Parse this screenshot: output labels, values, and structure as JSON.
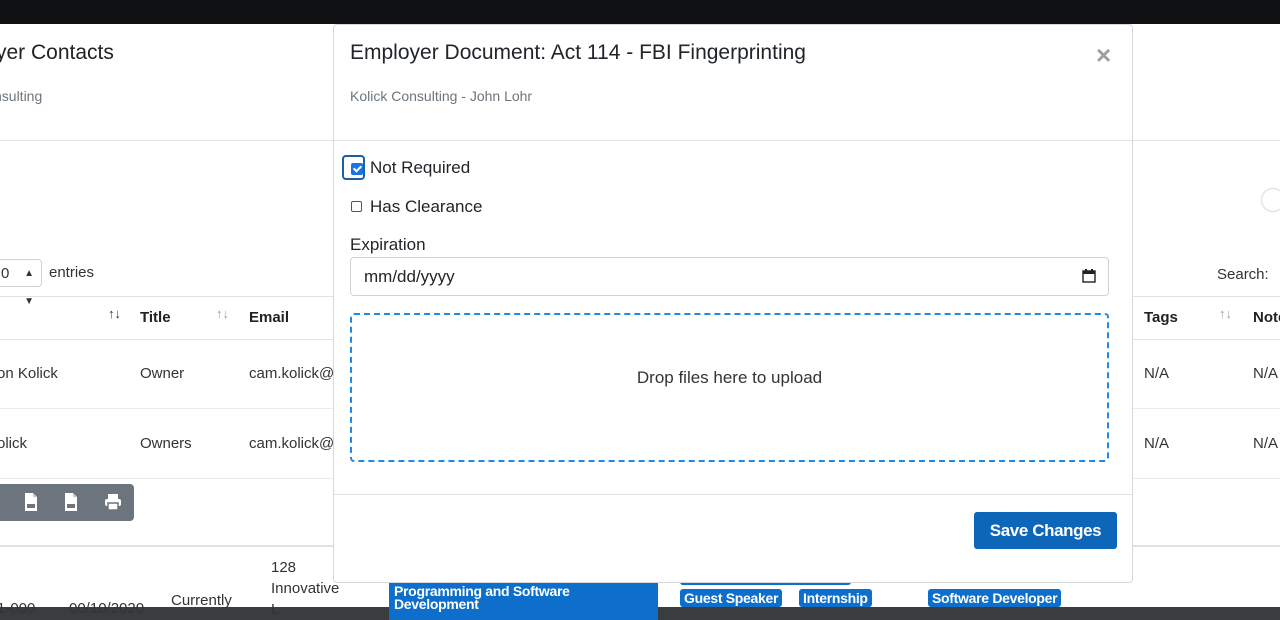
{
  "background": {
    "page_title": "yer Contacts",
    "page_subtitle": "nsulting",
    "entries_select_value": "0",
    "entries_label": "entries",
    "search_label": "Search:",
    "table": {
      "headers": {
        "name": "",
        "title": "Title",
        "email": "Email",
        "tags": "Tags",
        "notes": "Note"
      },
      "rows": [
        {
          "name": "on Kolick",
          "title": "Owner",
          "email": "cam.kolick@",
          "tags": "N/A",
          "notes": "N/A"
        },
        {
          "name": "olick",
          "title": "Owners",
          "email": "cam.kolick@",
          "tags": "N/A",
          "notes": "N/A"
        }
      ]
    },
    "export_buttons": [
      "csv-icon",
      "pdf-icon",
      "print-icon"
    ],
    "bottom_row": {
      "col1": "1-000",
      "col2": "00/10/2020",
      "col3": "Currently",
      "address_lines": [
        "128",
        "Innovative",
        "L"
      ],
      "big_tag_lines": [
        "Programming and Software",
        "Development"
      ],
      "tags": [
        "Guest Speaker",
        "Internship"
      ],
      "role_tag": "Software Developer"
    }
  },
  "modal": {
    "title": "Employer Document: Act 114 - FBI Fingerprinting",
    "subtitle": "Kolick Consulting - John Lohr",
    "close_symbol": "×",
    "not_required_label": "Not Required",
    "not_required_checked": true,
    "has_clearance_label": "Has Clearance",
    "has_clearance_checked": false,
    "expiration_label": "Expiration",
    "expiration_placeholder": "mm/dd/yyyy",
    "dropzone_text": "Drop files here to upload",
    "save_label": "Save Changes"
  },
  "colors": {
    "primary": "#0d66b8",
    "tag": "#0d6ecb",
    "dropzone_border": "#1f8ae6",
    "checkbox_checked": "#1a73e8",
    "muted": "#6c757d"
  }
}
